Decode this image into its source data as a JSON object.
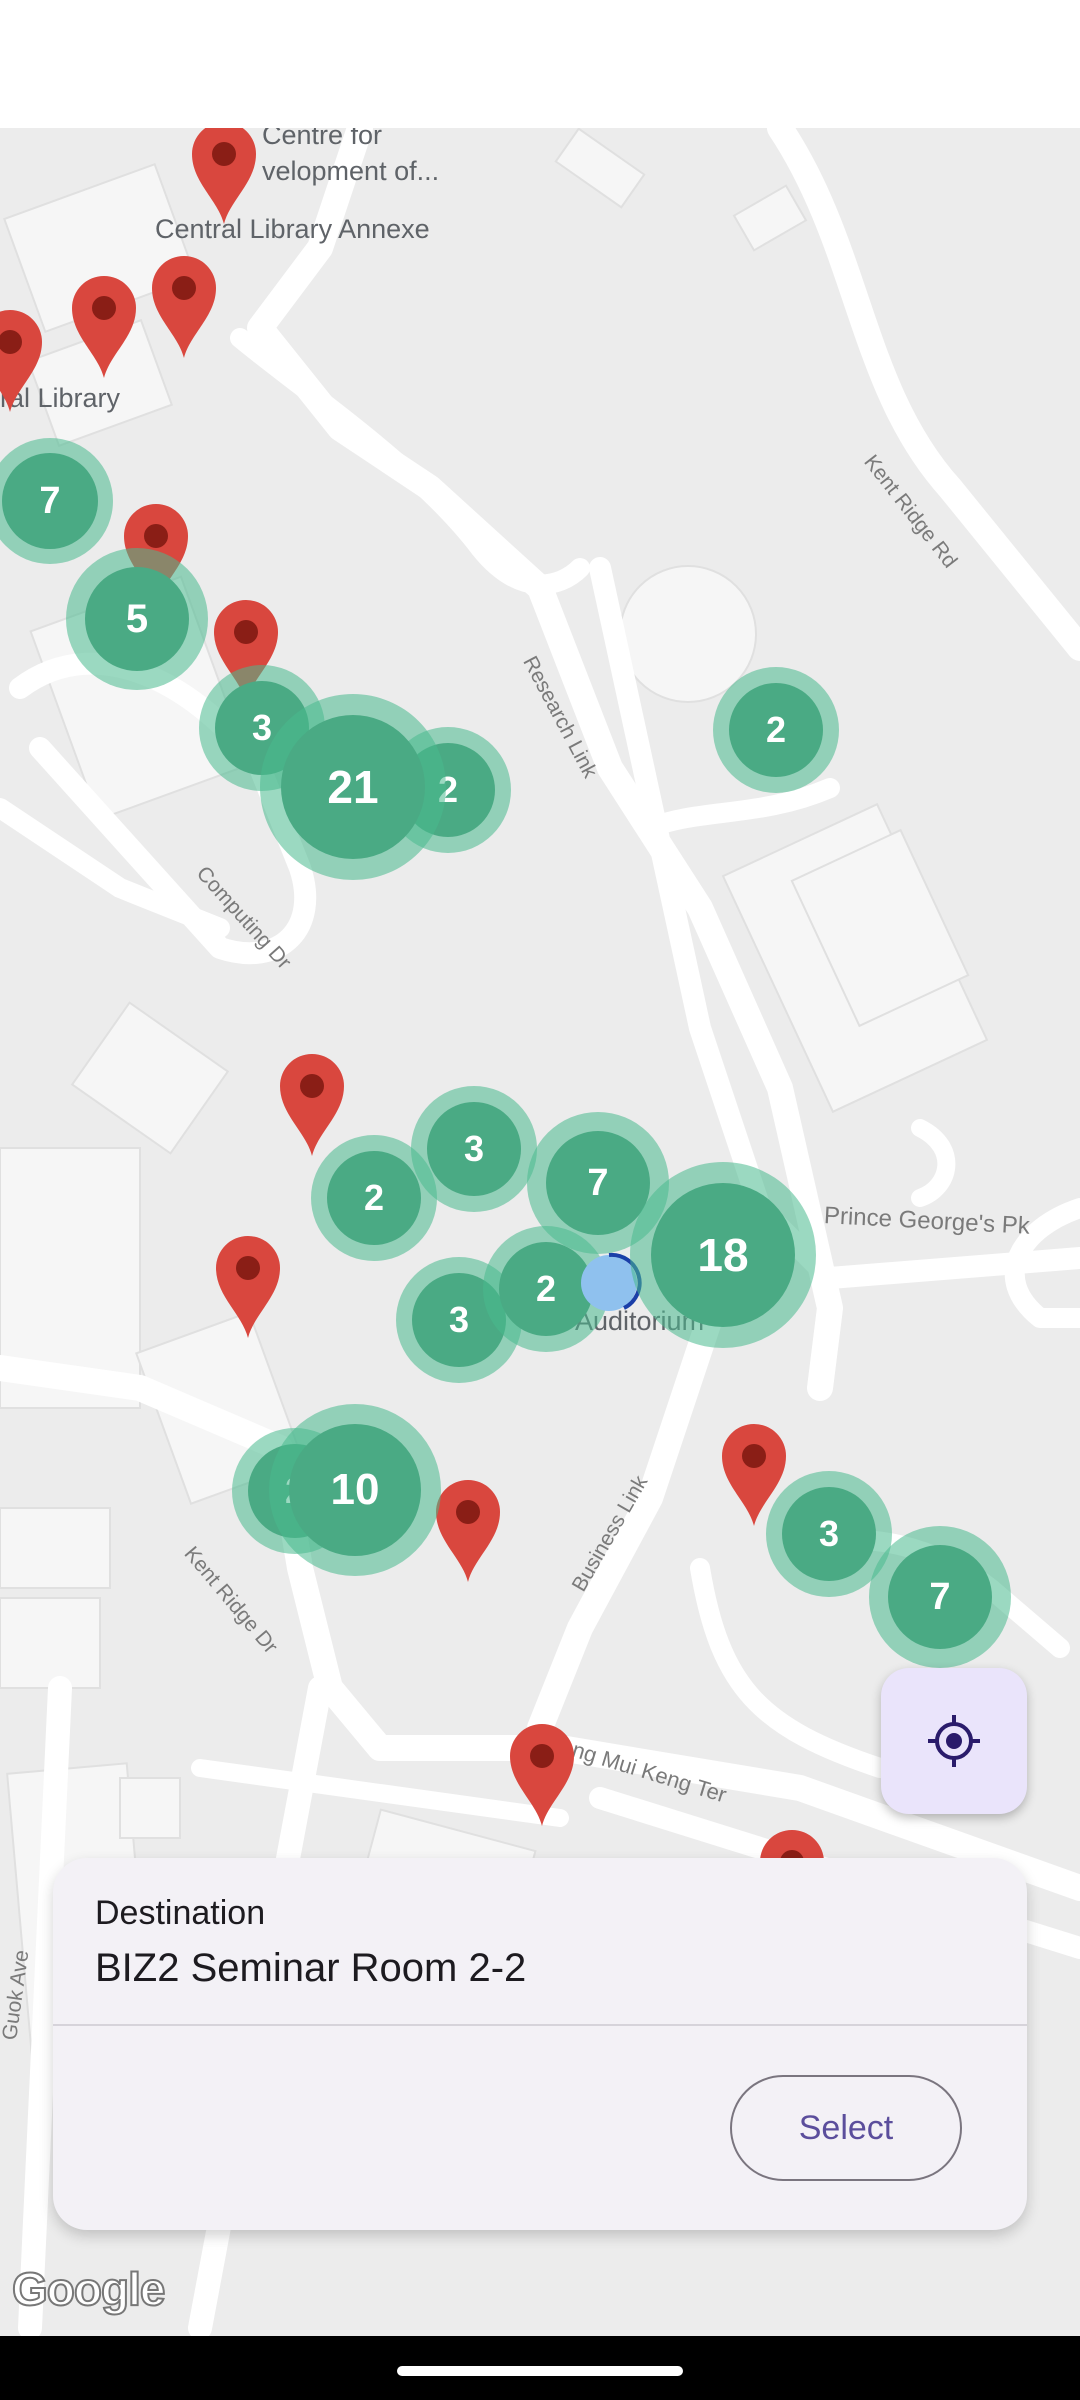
{
  "map": {
    "places": {
      "centre_line1": "Centre for",
      "centre_line2": "velopment of...",
      "library_annexe": "Central Library Annexe",
      "library": "ral Library",
      "auditorium": "Auditorium"
    },
    "roads": {
      "kent_ridge_rd": "Kent Ridge Rd",
      "research_link": "Research Link",
      "computing_dr": "Computing Dr",
      "prince_georges_pk": "Prince George's Pk",
      "business_link": "Business Link",
      "kent_ridge_dr": "Kent Ridge Dr",
      "heng_mui_keng_ter": "Heng Mui Keng Ter",
      "guok_ave": "Guok Ave"
    },
    "clusters": [
      "7",
      "5",
      "3",
      "21",
      "2",
      "2",
      "3",
      "7",
      "2",
      "3",
      "2",
      "18",
      "10",
      "2",
      "3",
      "7"
    ],
    "attribution": "Google"
  },
  "fab": {
    "icon": "my-location-icon"
  },
  "sheet": {
    "destination_label": "Destination",
    "destination_name": "BIZ2 Seminar Room 2-2",
    "select_label": "Select"
  },
  "colors": {
    "cluster": "#4aaa84",
    "pin": "#d9473e",
    "accent": "#5b4e9c"
  }
}
